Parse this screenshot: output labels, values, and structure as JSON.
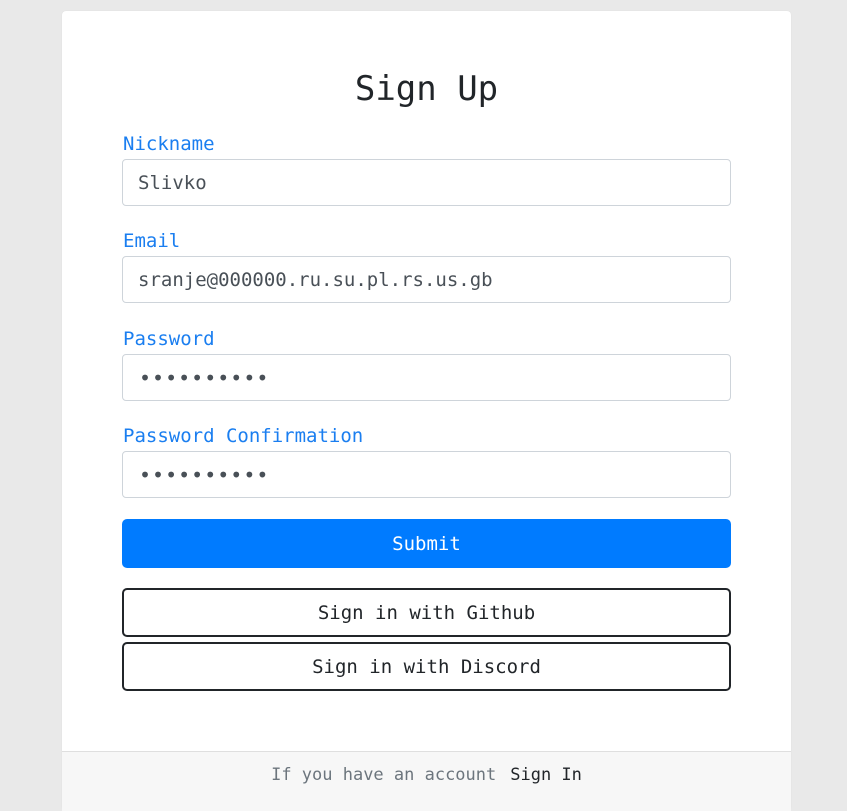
{
  "form": {
    "title": "Sign Up",
    "fields": {
      "nickname": {
        "label": "Nickname",
        "value": "Slivko"
      },
      "email": {
        "label": "Email",
        "value": "sranje@000000.ru.su.pl.rs.us.gb"
      },
      "password": {
        "label": "Password",
        "value": "••••••••••"
      },
      "password_confirmation": {
        "label": "Password Confirmation",
        "value": "••••••••••"
      }
    },
    "submit_label": "Submit",
    "github_label": "Sign in with Github",
    "discord_label": "Sign in with Discord"
  },
  "footer": {
    "text": "If you have an account",
    "link_label": "Sign In"
  },
  "colors": {
    "accent": "#007bff",
    "label": "#1a7ef0",
    "background": "#e9e9e9"
  }
}
